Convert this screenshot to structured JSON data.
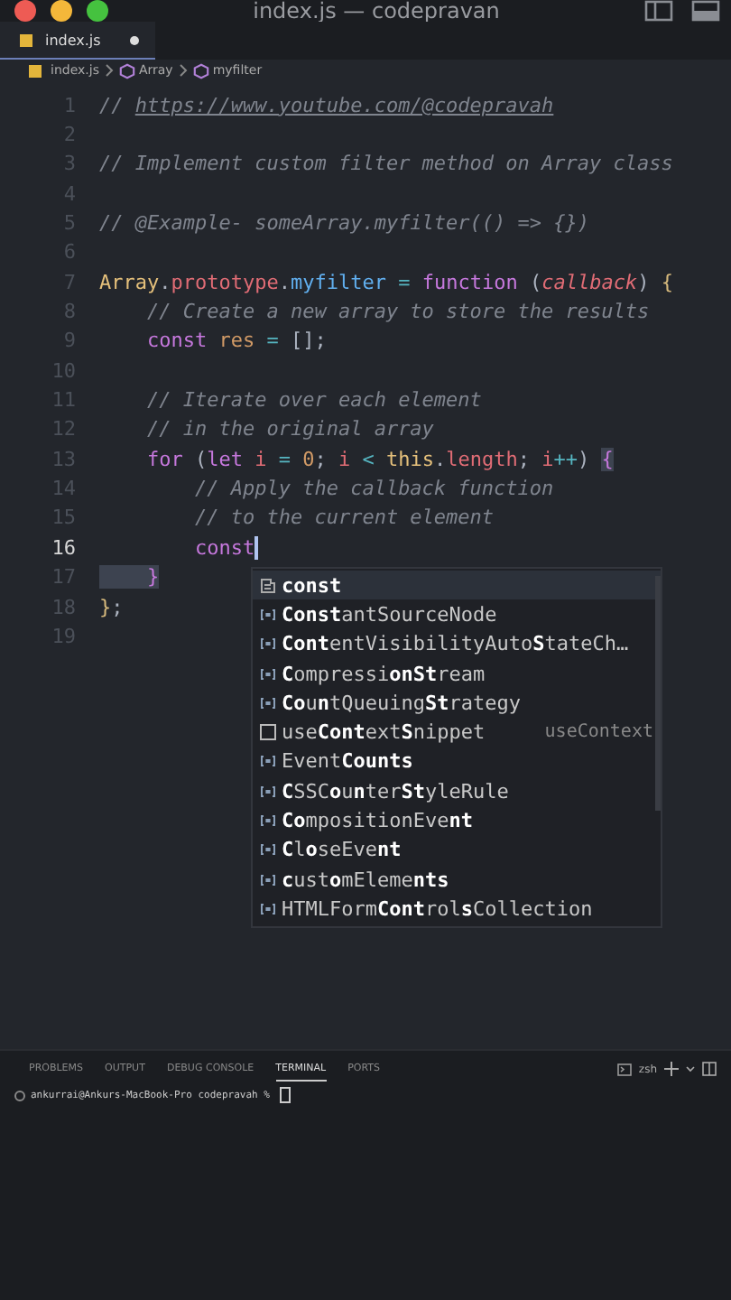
{
  "window": {
    "title": "index.js — codepravan"
  },
  "tabs": [
    {
      "label": "index.js",
      "selected": true,
      "modified": true
    }
  ],
  "breadcrumbs": [
    {
      "label": "index.js",
      "kind": "file"
    },
    {
      "label": "Array",
      "kind": "symbol"
    },
    {
      "label": "myfilter",
      "kind": "symbol"
    }
  ],
  "editor": {
    "lines": [
      {
        "number": "1",
        "current": false,
        "tokens": [
          {
            "kind": "comment",
            "text": "// "
          },
          {
            "kind": "link",
            "text": "https://www.youtube.com/@codepravah"
          }
        ]
      },
      {
        "number": "2",
        "current": false
      },
      {
        "number": "3",
        "current": false,
        "tokens": [
          {
            "kind": "comment",
            "text": "// Implement custom filter method on Array class"
          }
        ]
      },
      {
        "number": "4",
        "current": false
      },
      {
        "number": "5",
        "current": false,
        "tokens": [
          {
            "kind": "comment",
            "text": "// @Example- someArray.myfilter(() => {})"
          }
        ]
      },
      {
        "number": "6",
        "current": false
      },
      {
        "number": "7",
        "current": false,
        "tokens": [
          {
            "kind": "class",
            "text": "Array"
          },
          {
            "kind": "plain",
            "text": "."
          },
          {
            "kind": "prop",
            "text": "prototype"
          },
          {
            "kind": "plain",
            "text": "."
          },
          {
            "kind": "func",
            "text": "myfilter"
          },
          {
            "kind": "op",
            "text": " = "
          },
          {
            "kind": "keyword",
            "text": "function"
          },
          {
            "kind": "plain",
            "text": " ("
          },
          {
            "kind": "param",
            "text": "callback"
          },
          {
            "kind": "plain",
            "text": ") "
          },
          {
            "kind": "brace",
            "text": "{"
          }
        ]
      },
      {
        "number": "8",
        "current": false,
        "tokens": [
          {
            "kind": "comment",
            "text": "    // Create a new array to store the results"
          }
        ]
      },
      {
        "number": "9",
        "current": false,
        "tokens": [
          {
            "kind": "keyword",
            "text": "    const"
          },
          {
            "kind": "var",
            "text": " res"
          },
          {
            "kind": "op",
            "text": " = "
          },
          {
            "kind": "plain",
            "text": "[];"
          }
        ]
      },
      {
        "number": "10",
        "current": false
      },
      {
        "number": "11",
        "current": false,
        "tokens": [
          {
            "kind": "comment",
            "text": "    // Iterate over each element"
          }
        ]
      },
      {
        "number": "12",
        "current": false,
        "tokens": [
          {
            "kind": "comment",
            "text": "    // in the original array"
          }
        ]
      },
      {
        "number": "13",
        "current": false,
        "tokens": [
          {
            "kind": "keyword",
            "text": "    for"
          },
          {
            "kind": "plain",
            "text": " ("
          },
          {
            "kind": "keyword",
            "text": "let"
          },
          {
            "kind": "prop",
            "text": " i"
          },
          {
            "kind": "op",
            "text": " = "
          },
          {
            "kind": "number",
            "text": "0"
          },
          {
            "kind": "plain",
            "text": "; "
          },
          {
            "kind": "prop",
            "text": "i"
          },
          {
            "kind": "op",
            "text": " < "
          },
          {
            "kind": "class",
            "text": "this"
          },
          {
            "kind": "plain",
            "text": "."
          },
          {
            "kind": "prop",
            "text": "length"
          },
          {
            "kind": "plain",
            "text": "; "
          },
          {
            "kind": "prop",
            "text": "i"
          },
          {
            "kind": "op",
            "text": "++"
          },
          {
            "kind": "plain",
            "text": ") "
          },
          {
            "kind": "brace-match",
            "text": "{"
          }
        ]
      },
      {
        "number": "14",
        "current": false,
        "tokens": [
          {
            "kind": "comment",
            "text": "        // Apply the callback function"
          }
        ]
      },
      {
        "number": "15",
        "current": false,
        "tokens": [
          {
            "kind": "comment",
            "text": "        // to the current element"
          }
        ]
      },
      {
        "number": "16",
        "current": true,
        "tokens": [
          {
            "kind": "keyword",
            "text": "        const"
          }
        ]
      },
      {
        "number": "17",
        "current": false,
        "tokens": [
          {
            "kind": "brace-match",
            "text": "    }"
          }
        ]
      },
      {
        "number": "18",
        "current": false,
        "tokens": [
          {
            "kind": "brace",
            "text": "}"
          },
          {
            "kind": "plain",
            "text": ";"
          }
        ]
      },
      {
        "number": "19",
        "current": false
      }
    ]
  },
  "suggestions": [
    {
      "label": "**const**",
      "kind": "keyword",
      "selected": true
    },
    {
      "label": "**Const**antSourceNode",
      "kind": "variable",
      "selected": false
    },
    {
      "label": "**Cont**entVisibilityAuto**S**tateCh…",
      "kind": "variable",
      "selected": false
    },
    {
      "label": "**C**ompressi**onSt**ream",
      "kind": "variable",
      "selected": false
    },
    {
      "label": "**Co**u**n**tQueuing**St**rategy",
      "kind": "variable",
      "selected": false
    },
    {
      "label": "use**Cont**ext**S**nippet",
      "kind": "snippet",
      "selected": false,
      "detail": "useContext"
    },
    {
      "label": "Event**Counts**",
      "kind": "variable",
      "selected": false
    },
    {
      "label": "**C**SSC**o**u**n**ter**St**yleRule",
      "kind": "variable",
      "selected": false
    },
    {
      "label": "**Co**mpositionEve**nt**",
      "kind": "variable",
      "selected": false
    },
    {
      "label": "**C**l**o**seEve**nt**",
      "kind": "variable",
      "selected": false
    },
    {
      "label": "**c**ust**o**mEleme**nts**",
      "kind": "variable",
      "selected": false
    },
    {
      "label": "HTMLForm**Cont**rol**s**Collection",
      "kind": "variable",
      "selected": false
    }
  ],
  "panel": {
    "tabs": [
      {
        "label": "PROBLEMS",
        "selected": false
      },
      {
        "label": "OUTPUT",
        "selected": false
      },
      {
        "label": "DEBUG CONSOLE",
        "selected": false
      },
      {
        "label": "TERMINAL",
        "selected": true
      },
      {
        "label": "PORTS",
        "selected": false
      }
    ],
    "shell": "zsh",
    "prompt": "ankurrai@Ankurs-MacBook-Pro codepravah %"
  }
}
